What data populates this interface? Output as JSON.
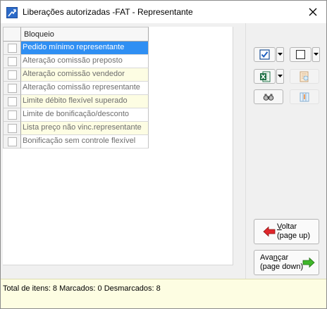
{
  "window": {
    "title": "Liberações autorizadas -FAT - Representante"
  },
  "grid": {
    "column_header": "Bloqueio",
    "rows": [
      {
        "label": "Pedido mínimo representante",
        "checked": false,
        "selected": true
      },
      {
        "label": "Alteração comissão preposto",
        "checked": false,
        "selected": false
      },
      {
        "label": "Alteração comissão vendedor",
        "checked": false,
        "selected": false
      },
      {
        "label": "Alteração comissão representante",
        "checked": false,
        "selected": false
      },
      {
        "label": "Limite débito flexível superado",
        "checked": false,
        "selected": false
      },
      {
        "label": "Limite de bonificação/desconto",
        "checked": false,
        "selected": false
      },
      {
        "label": "Lista preço não vinc.representante",
        "checked": false,
        "selected": false
      },
      {
        "label": "Bonificação sem controle flexível",
        "checked": false,
        "selected": false
      }
    ]
  },
  "toolbar": {
    "check_all_icon": "check-all-icon",
    "uncheck_all_icon": "uncheck-all-icon",
    "excel_icon": "excel-icon",
    "print_preview_icon": "print-preview-icon",
    "find_icon": "binoculars-icon",
    "columns_icon": "columns-icon"
  },
  "buttons": {
    "back_key": "V",
    "back_rest": "oltar",
    "back_line2": "(page up)",
    "next_pre": "Ava",
    "next_key": "n",
    "next_rest": "çar",
    "next_line2": "(page down)"
  },
  "status": {
    "text": "Total de itens: 8 Marcados: 0 Desmarcados: 8"
  },
  "colors": {
    "selection": "#2f8ff3",
    "alt_row": "#fdfde3",
    "status_bg": "#fdfde2",
    "back_arrow": "#e0262b",
    "next_arrow": "#3fb72a"
  }
}
